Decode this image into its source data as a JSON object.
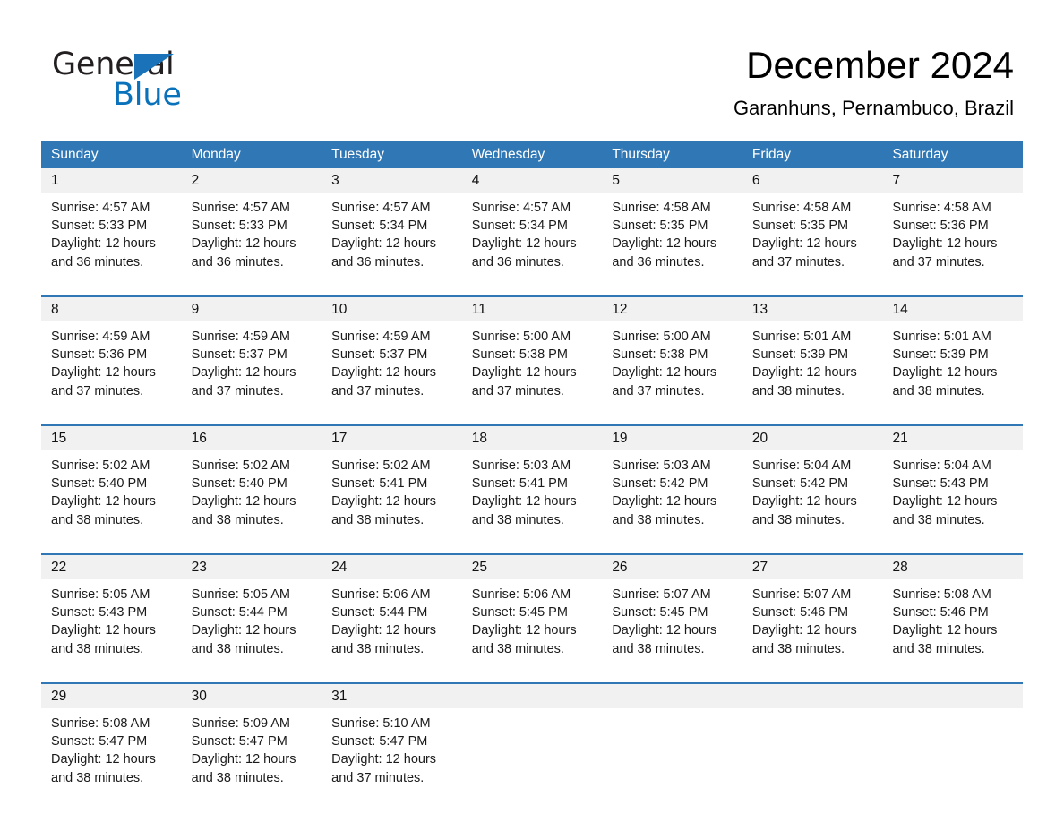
{
  "logo": {
    "word_one": "General",
    "word_two": "Blue",
    "triangle_color": "#1a72b8",
    "blue_text_color": "#0a72bb"
  },
  "header": {
    "month_title": "December 2024",
    "location": "Garanhuns, Pernambuco, Brazil"
  },
  "colors": {
    "header_blue": "#2f77b5",
    "date_strip_gray": "#f1f1f1",
    "row_rule_blue": "#2f77b5"
  },
  "weekdays": [
    "Sunday",
    "Monday",
    "Tuesday",
    "Wednesday",
    "Thursday",
    "Friday",
    "Saturday"
  ],
  "weeks": [
    {
      "days": [
        {
          "date": "1",
          "sunrise": "Sunrise: 4:57 AM",
          "sunset": "Sunset: 5:33 PM",
          "daylight": "Daylight: 12 hours and 36 minutes."
        },
        {
          "date": "2",
          "sunrise": "Sunrise: 4:57 AM",
          "sunset": "Sunset: 5:33 PM",
          "daylight": "Daylight: 12 hours and 36 minutes."
        },
        {
          "date": "3",
          "sunrise": "Sunrise: 4:57 AM",
          "sunset": "Sunset: 5:34 PM",
          "daylight": "Daylight: 12 hours and 36 minutes."
        },
        {
          "date": "4",
          "sunrise": "Sunrise: 4:57 AM",
          "sunset": "Sunset: 5:34 PM",
          "daylight": "Daylight: 12 hours and 36 minutes."
        },
        {
          "date": "5",
          "sunrise": "Sunrise: 4:58 AM",
          "sunset": "Sunset: 5:35 PM",
          "daylight": "Daylight: 12 hours and 36 minutes."
        },
        {
          "date": "6",
          "sunrise": "Sunrise: 4:58 AM",
          "sunset": "Sunset: 5:35 PM",
          "daylight": "Daylight: 12 hours and 37 minutes."
        },
        {
          "date": "7",
          "sunrise": "Sunrise: 4:58 AM",
          "sunset": "Sunset: 5:36 PM",
          "daylight": "Daylight: 12 hours and 37 minutes."
        }
      ]
    },
    {
      "days": [
        {
          "date": "8",
          "sunrise": "Sunrise: 4:59 AM",
          "sunset": "Sunset: 5:36 PM",
          "daylight": "Daylight: 12 hours and 37 minutes."
        },
        {
          "date": "9",
          "sunrise": "Sunrise: 4:59 AM",
          "sunset": "Sunset: 5:37 PM",
          "daylight": "Daylight: 12 hours and 37 minutes."
        },
        {
          "date": "10",
          "sunrise": "Sunrise: 4:59 AM",
          "sunset": "Sunset: 5:37 PM",
          "daylight": "Daylight: 12 hours and 37 minutes."
        },
        {
          "date": "11",
          "sunrise": "Sunrise: 5:00 AM",
          "sunset": "Sunset: 5:38 PM",
          "daylight": "Daylight: 12 hours and 37 minutes."
        },
        {
          "date": "12",
          "sunrise": "Sunrise: 5:00 AM",
          "sunset": "Sunset: 5:38 PM",
          "daylight": "Daylight: 12 hours and 37 minutes."
        },
        {
          "date": "13",
          "sunrise": "Sunrise: 5:01 AM",
          "sunset": "Sunset: 5:39 PM",
          "daylight": "Daylight: 12 hours and 38 minutes."
        },
        {
          "date": "14",
          "sunrise": "Sunrise: 5:01 AM",
          "sunset": "Sunset: 5:39 PM",
          "daylight": "Daylight: 12 hours and 38 minutes."
        }
      ]
    },
    {
      "days": [
        {
          "date": "15",
          "sunrise": "Sunrise: 5:02 AM",
          "sunset": "Sunset: 5:40 PM",
          "daylight": "Daylight: 12 hours and 38 minutes."
        },
        {
          "date": "16",
          "sunrise": "Sunrise: 5:02 AM",
          "sunset": "Sunset: 5:40 PM",
          "daylight": "Daylight: 12 hours and 38 minutes."
        },
        {
          "date": "17",
          "sunrise": "Sunrise: 5:02 AM",
          "sunset": "Sunset: 5:41 PM",
          "daylight": "Daylight: 12 hours and 38 minutes."
        },
        {
          "date": "18",
          "sunrise": "Sunrise: 5:03 AM",
          "sunset": "Sunset: 5:41 PM",
          "daylight": "Daylight: 12 hours and 38 minutes."
        },
        {
          "date": "19",
          "sunrise": "Sunrise: 5:03 AM",
          "sunset": "Sunset: 5:42 PM",
          "daylight": "Daylight: 12 hours and 38 minutes."
        },
        {
          "date": "20",
          "sunrise": "Sunrise: 5:04 AM",
          "sunset": "Sunset: 5:42 PM",
          "daylight": "Daylight: 12 hours and 38 minutes."
        },
        {
          "date": "21",
          "sunrise": "Sunrise: 5:04 AM",
          "sunset": "Sunset: 5:43 PM",
          "daylight": "Daylight: 12 hours and 38 minutes."
        }
      ]
    },
    {
      "days": [
        {
          "date": "22",
          "sunrise": "Sunrise: 5:05 AM",
          "sunset": "Sunset: 5:43 PM",
          "daylight": "Daylight: 12 hours and 38 minutes."
        },
        {
          "date": "23",
          "sunrise": "Sunrise: 5:05 AM",
          "sunset": "Sunset: 5:44 PM",
          "daylight": "Daylight: 12 hours and 38 minutes."
        },
        {
          "date": "24",
          "sunrise": "Sunrise: 5:06 AM",
          "sunset": "Sunset: 5:44 PM",
          "daylight": "Daylight: 12 hours and 38 minutes."
        },
        {
          "date": "25",
          "sunrise": "Sunrise: 5:06 AM",
          "sunset": "Sunset: 5:45 PM",
          "daylight": "Daylight: 12 hours and 38 minutes."
        },
        {
          "date": "26",
          "sunrise": "Sunrise: 5:07 AM",
          "sunset": "Sunset: 5:45 PM",
          "daylight": "Daylight: 12 hours and 38 minutes."
        },
        {
          "date": "27",
          "sunrise": "Sunrise: 5:07 AM",
          "sunset": "Sunset: 5:46 PM",
          "daylight": "Daylight: 12 hours and 38 minutes."
        },
        {
          "date": "28",
          "sunrise": "Sunrise: 5:08 AM",
          "sunset": "Sunset: 5:46 PM",
          "daylight": "Daylight: 12 hours and 38 minutes."
        }
      ]
    },
    {
      "days": [
        {
          "date": "29",
          "sunrise": "Sunrise: 5:08 AM",
          "sunset": "Sunset: 5:47 PM",
          "daylight": "Daylight: 12 hours and 38 minutes."
        },
        {
          "date": "30",
          "sunrise": "Sunrise: 5:09 AM",
          "sunset": "Sunset: 5:47 PM",
          "daylight": "Daylight: 12 hours and 38 minutes."
        },
        {
          "date": "31",
          "sunrise": "Sunrise: 5:10 AM",
          "sunset": "Sunset: 5:47 PM",
          "daylight": "Daylight: 12 hours and 37 minutes."
        },
        {
          "date": "",
          "sunrise": "",
          "sunset": "",
          "daylight": ""
        },
        {
          "date": "",
          "sunrise": "",
          "sunset": "",
          "daylight": ""
        },
        {
          "date": "",
          "sunrise": "",
          "sunset": "",
          "daylight": ""
        },
        {
          "date": "",
          "sunrise": "",
          "sunset": "",
          "daylight": ""
        }
      ]
    }
  ]
}
